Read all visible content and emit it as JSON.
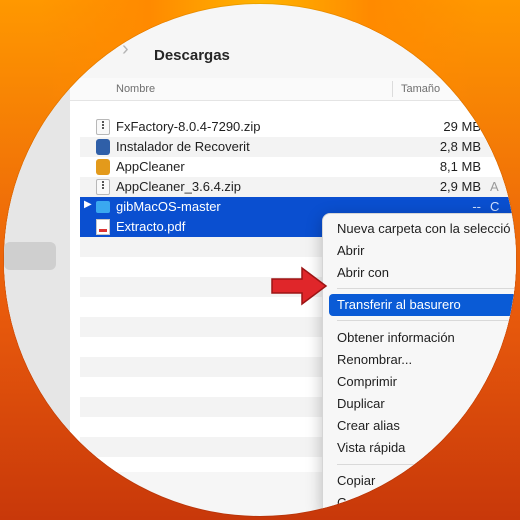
{
  "finder": {
    "title": "Descargas",
    "columns": {
      "name": "Nombre",
      "size": "Tamaño"
    }
  },
  "files": [
    {
      "name": "FxFactory-8.0.4-7290.zip",
      "size": "29 MB",
      "kind": "",
      "icon": "zip-file-icon"
    },
    {
      "name": "Instalador de Recoverit",
      "size": "2,8 MB",
      "kind": "",
      "icon": "installer-icon"
    },
    {
      "name": "AppCleaner",
      "size": "8,1 MB",
      "kind": "",
      "icon": "app-icon"
    },
    {
      "name": "AppCleaner_3.6.4.zip",
      "size": "2,9 MB",
      "kind": "A",
      "icon": "zip-file-icon"
    },
    {
      "name": "gibMacOS-master",
      "size": "--",
      "kind": "C",
      "icon": "folder-icon",
      "selected": true
    },
    {
      "name": "Extracto.pdf",
      "size": "",
      "kind": "",
      "icon": "pdf-file-icon",
      "selected": true
    }
  ],
  "context_menu": {
    "items": [
      {
        "label": "Nueva carpeta con la selecció"
      },
      {
        "label": "Abrir"
      },
      {
        "label": "Abrir con"
      },
      {
        "label": "Transferir al basurero",
        "highlighted": true
      },
      {
        "label": "Obtener información"
      },
      {
        "label": "Renombrar..."
      },
      {
        "label": "Comprimir"
      },
      {
        "label": "Duplicar"
      },
      {
        "label": "Crear alias"
      },
      {
        "label": "Vista rápida"
      },
      {
        "label": "Copiar"
      },
      {
        "label": "Co"
      }
    ]
  },
  "colors": {
    "selection": "#0a4fd0",
    "menu_highlight": "#0a5bd6",
    "arrow": "#e0262a"
  }
}
